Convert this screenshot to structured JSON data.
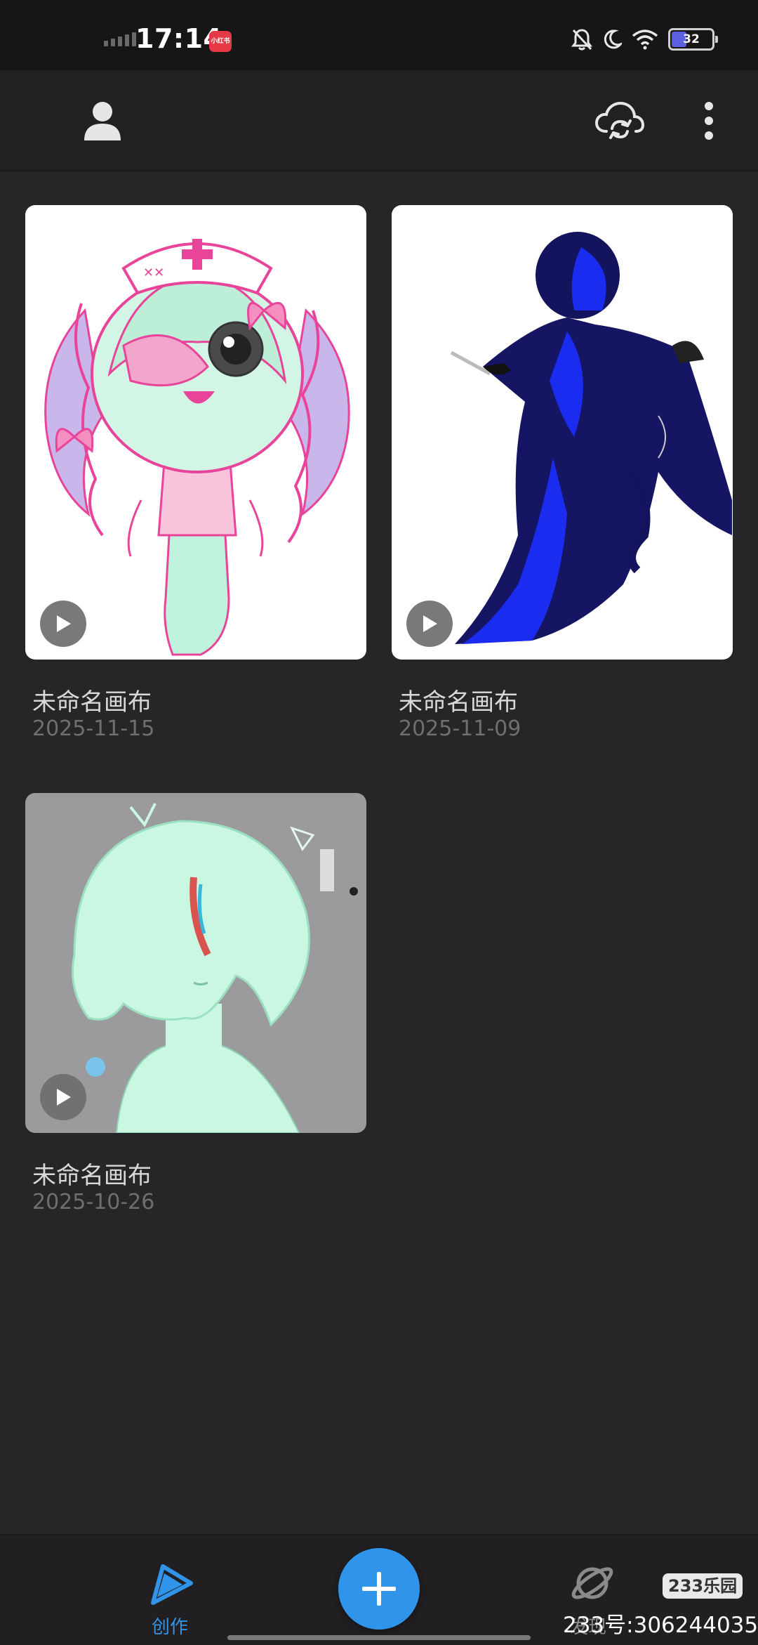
{
  "status_bar": {
    "time": "17:14",
    "app_badge": "小红书",
    "battery_level": "32",
    "icons": [
      "signal-icon",
      "notifications-off-icon",
      "moon-icon",
      "wifi-icon",
      "battery-icon"
    ]
  },
  "app_bar": {
    "icons": [
      "profile-icon",
      "cloud-sync-icon",
      "more-vertical-icon"
    ]
  },
  "canvases": [
    {
      "title": "未命名画布",
      "date": "2025-11-15"
    },
    {
      "title": "未命名画布",
      "date": "2025-11-09"
    },
    {
      "title": "未命名画布",
      "date": "2025-10-26"
    }
  ],
  "bottom_nav": {
    "create_label": "创作",
    "discover_label": "发现",
    "fab_icon": "plus-icon"
  },
  "watermark": {
    "logo": "233乐园",
    "text": "233号:306244035"
  },
  "colors": {
    "background": "#262528",
    "accent": "#2f94ea",
    "title_text": "#d8d8d8",
    "date_text": "#6f6f72"
  }
}
